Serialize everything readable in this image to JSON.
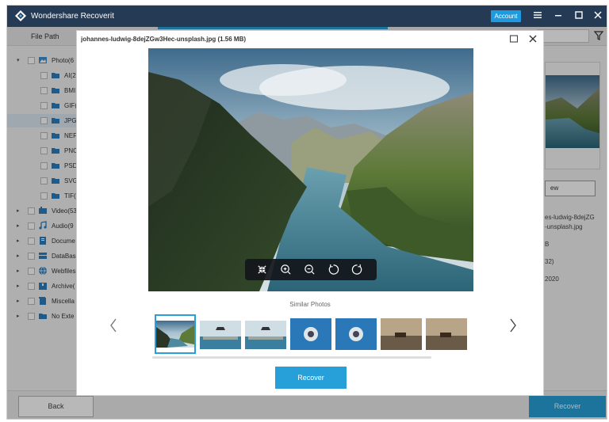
{
  "app": {
    "title": "Wondershare Recoverit",
    "account_label": "Account",
    "brand_color": "#243a55",
    "accent_color": "#27a0d9"
  },
  "header": {
    "file_path_label": "File Path"
  },
  "tree": {
    "items": [
      {
        "label": "Photo(6",
        "icon": "photo-icon",
        "level": 0,
        "expanded": true
      },
      {
        "label": "AI(2",
        "icon": "folder-icon",
        "level": 1
      },
      {
        "label": "BMI",
        "icon": "folder-icon",
        "level": 1
      },
      {
        "label": "GIF(",
        "icon": "folder-icon",
        "level": 1
      },
      {
        "label": "JPG(",
        "icon": "folder-icon",
        "level": 1,
        "selected": true
      },
      {
        "label": "NEF",
        "icon": "folder-icon",
        "level": 1
      },
      {
        "label": "PNC",
        "icon": "folder-icon",
        "level": 1
      },
      {
        "label": "PSD",
        "icon": "folder-icon",
        "level": 1
      },
      {
        "label": "SVG",
        "icon": "folder-icon",
        "level": 1
      },
      {
        "label": "TIF(",
        "icon": "folder-icon",
        "level": 1
      },
      {
        "label": "Video(53",
        "icon": "video-icon",
        "level": 0
      },
      {
        "label": "Audio(9",
        "icon": "audio-icon",
        "level": 0
      },
      {
        "label": "Docume",
        "icon": "document-icon",
        "level": 0
      },
      {
        "label": "DataBas",
        "icon": "database-icon",
        "level": 0
      },
      {
        "label": "Webfiles",
        "icon": "web-icon",
        "level": 0
      },
      {
        "label": "Archive(",
        "icon": "archive-icon",
        "level": 0
      },
      {
        "label": "Miscella",
        "icon": "misc-icon",
        "level": 0
      },
      {
        "label": "No Exte",
        "icon": "no-extension-icon",
        "level": 0
      }
    ]
  },
  "details": {
    "preview_button_label": "ew",
    "name_line1": "es-ludwig-8dejZG",
    "name_line2": "-unsplash.jpg",
    "size_fragment": "B",
    "dimension_fragment": "32)",
    "date_fragment": "2020"
  },
  "modal": {
    "title": "johannes-ludwig-8dejZGw3Hec-unsplash.jpg (1.56 MB)",
    "similar_photos_label": "Similar Photos",
    "recover_label": "Recover",
    "toolbar_icons": [
      "fit-screen-icon",
      "zoom-in-icon",
      "zoom-out-icon",
      "rotate-left-icon",
      "rotate-right-icon"
    ]
  },
  "footer": {
    "back_label": "Back",
    "recover_label": "Recover"
  }
}
